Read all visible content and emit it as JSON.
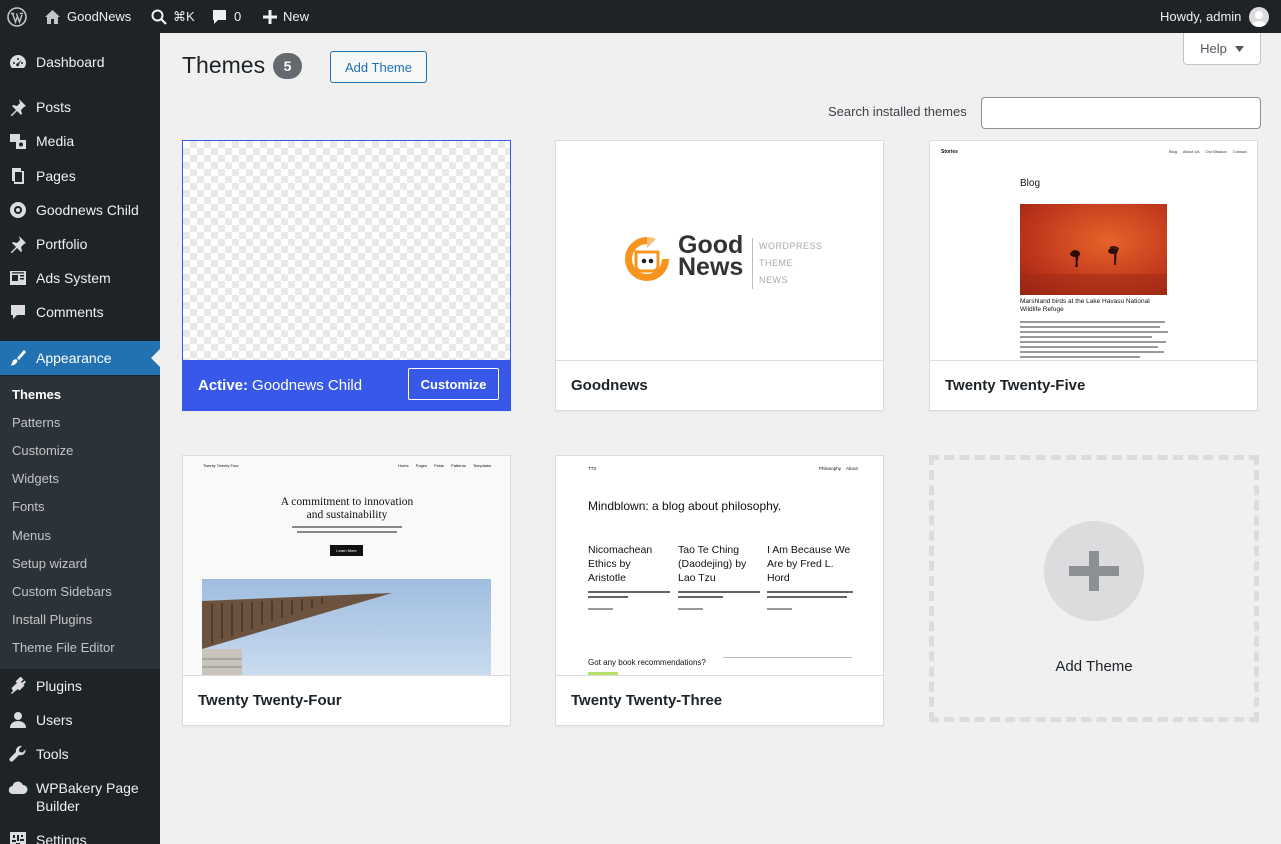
{
  "admin_bar": {
    "site_name": "GoodNews",
    "search_shortcut": "⌘K",
    "comments_count": "0",
    "new_label": "New",
    "howdy": "Howdy, admin"
  },
  "sidebar": {
    "items": [
      {
        "label": "Dashboard",
        "icon": "dashboard-icon"
      },
      {
        "label": "Posts",
        "icon": "pin-icon"
      },
      {
        "label": "Media",
        "icon": "media-icon"
      },
      {
        "label": "Pages",
        "icon": "pages-icon"
      },
      {
        "label": "Goodnews Child",
        "icon": "theme-icon"
      },
      {
        "label": "Portfolio",
        "icon": "pin-icon"
      },
      {
        "label": "Ads System",
        "icon": "ads-icon"
      },
      {
        "label": "Comments",
        "icon": "comment-icon"
      },
      {
        "label": "Appearance",
        "icon": "brush-icon"
      },
      {
        "label": "Plugins",
        "icon": "plugin-icon"
      },
      {
        "label": "Users",
        "icon": "users-icon"
      },
      {
        "label": "Tools",
        "icon": "wrench-icon"
      },
      {
        "label": "WPBakery Page Builder",
        "icon": "cloud-icon"
      },
      {
        "label": "Settings",
        "icon": "settings-icon"
      }
    ],
    "submenu": [
      "Themes",
      "Patterns",
      "Customize",
      "Widgets",
      "Fonts",
      "Menus",
      "Setup wizard",
      "Custom Sidebars",
      "Install Plugins",
      "Theme File Editor"
    ]
  },
  "header": {
    "title": "Themes",
    "count": "5",
    "add_button": "Add Theme",
    "help": "Help"
  },
  "search": {
    "label": "Search installed themes",
    "value": ""
  },
  "themes": [
    {
      "name": "Goodnews Child",
      "active_prefix": "Active:",
      "customize": "Customize"
    },
    {
      "name": "Goodnews",
      "logo_good": "Good",
      "logo_news": "News",
      "logo_tagline": [
        "WORDPRESS",
        "THEME",
        "NEWS"
      ]
    },
    {
      "name": "Twenty Twenty-Five",
      "preview": {
        "site": "Stories",
        "nav": [
          "Blog",
          "About Us",
          "Our Mission",
          "Contact"
        ],
        "heading": "Blog",
        "caption": "Marshland birds at the Lake Havasu National Wildlife Refuge"
      }
    },
    {
      "name": "Twenty Twenty-Four",
      "preview": {
        "site": "Twenty Twenty Four",
        "nav": [
          "Home",
          "Pages",
          "Posts",
          "Patterns",
          "Templates"
        ],
        "headline": "A commitment to innovation and sustainability",
        "button": "Learn More"
      }
    },
    {
      "name": "Twenty Twenty-Three",
      "preview": {
        "site": "TT3",
        "nav": [
          "Philosophy",
          "About"
        ],
        "headline": "Mindblown: a blog about philosophy.",
        "posts": [
          "Nicomachean Ethics by Aristotle",
          "Tao Te Ching (Daodejing) by Lao Tzu",
          "I Am Because We Are by Fred L. Hord"
        ],
        "footer": "Got any book recommendations?"
      }
    }
  ],
  "add_new": {
    "label": "Add Theme"
  },
  "colors": {
    "sidebar": "#1d2327",
    "accent": "#2271b1",
    "active_theme": "#3858e9",
    "background": "#f0f0f1"
  }
}
